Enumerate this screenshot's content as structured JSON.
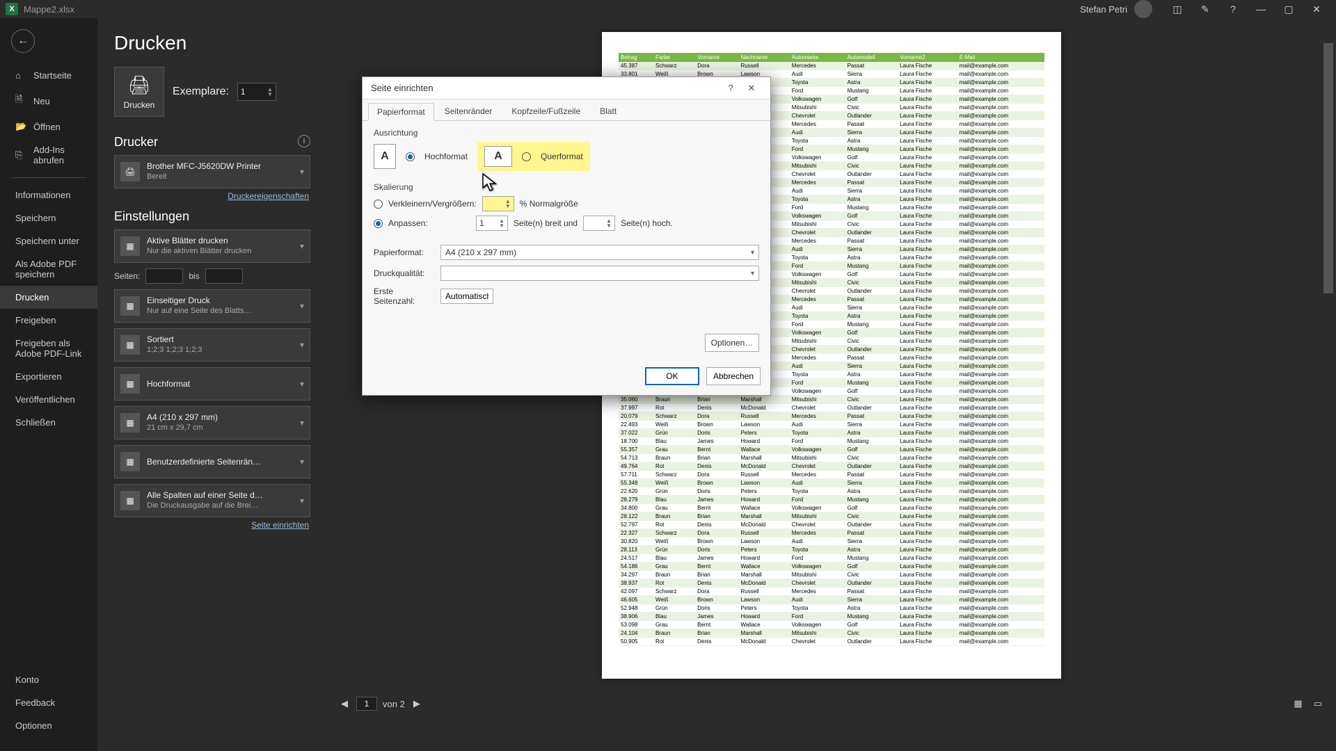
{
  "titlebar": {
    "filename": "Mappe2.xlsx",
    "user": "Stefan Petri"
  },
  "sidebar": {
    "items": [
      {
        "icon": "⌂",
        "label": "Startseite"
      },
      {
        "icon": "🗎",
        "label": "Neu"
      },
      {
        "icon": "📂",
        "label": "Öffnen"
      },
      {
        "icon": "⎘",
        "label": "Add-Ins abrufen"
      },
      {
        "icon": "",
        "label": "Informationen"
      },
      {
        "icon": "",
        "label": "Speichern"
      },
      {
        "icon": "",
        "label": "Speichern unter"
      },
      {
        "icon": "",
        "label": "Als Adobe PDF speichern"
      },
      {
        "icon": "",
        "label": "Drucken"
      },
      {
        "icon": "",
        "label": "Freigeben"
      },
      {
        "icon": "",
        "label": "Freigeben als Adobe PDF-Link"
      },
      {
        "icon": "",
        "label": "Exportieren"
      },
      {
        "icon": "",
        "label": "Veröffentlichen"
      },
      {
        "icon": "",
        "label": "Schließen"
      }
    ],
    "bottom": [
      "Konto",
      "Feedback",
      "Optionen"
    ]
  },
  "print": {
    "heading": "Drucken",
    "print_button": "Drucken",
    "copies_label": "Exemplare:",
    "copies_value": "1",
    "printer_heading": "Drucker",
    "printer_name": "Brother MFC-J5620DW Printer",
    "printer_status": "Bereit",
    "printer_props": "Druckereigenschaften",
    "settings_heading": "Einstellungen",
    "dd": [
      {
        "main": "Aktive Blätter drucken",
        "sub": "Nur die aktiven Blätter drucken"
      },
      {
        "main": "Einseitiger Druck",
        "sub": "Nur auf eine Seite des Blatts…"
      },
      {
        "main": "Sortiert",
        "sub": "1;2;3    1;2;3    1;2;3"
      },
      {
        "main": "Hochformat",
        "sub": ""
      },
      {
        "main": "A4 (210 x 297 mm)",
        "sub": "21 cm x 29,7 cm"
      },
      {
        "main": "Benutzerdefinierte Seitenrän…",
        "sub": ""
      },
      {
        "main": "Alle Spalten auf einer Seite d…",
        "sub": "Die Druckausgabe auf die Brei…"
      }
    ],
    "pages_label": "Seiten:",
    "pages_to": "bis",
    "page_setup_link": "Seite einrichten",
    "nav_current": "1",
    "nav_total": "von 2"
  },
  "dialog": {
    "title": "Seite einrichten",
    "tabs": [
      "Papierformat",
      "Seitenränder",
      "Kopfzeile/Fußzeile",
      "Blatt"
    ],
    "orientation_label": "Ausrichtung",
    "portrait": "Hochformat",
    "landscape": "Querformat",
    "scaling_label": "Skalierung",
    "zoom_label": "Verkleinern/Vergrößern:",
    "zoom_suffix": "% Normalgröße",
    "fit_label": "Anpassen:",
    "fit_wide": "1",
    "fit_wide_suffix": "Seite(n) breit und",
    "fit_tall": "",
    "fit_tall_suffix": "Seite(n) hoch.",
    "paper_label": "Papierformat:",
    "paper_value": "A4 (210 x 297 mm)",
    "quality_label": "Druckqualität:",
    "quality_value": "",
    "first_page_label": "Erste Seitenzahl:",
    "first_page_value": "Automatisch",
    "options_btn": "Optionen…",
    "ok": "OK",
    "cancel": "Abbrechen"
  },
  "preview": {
    "headers": [
      "Betrag",
      "Farbe",
      "Vorname",
      "Nachname",
      "Automarke",
      "Automodell",
      "Vorname2",
      "E-Mail"
    ]
  }
}
